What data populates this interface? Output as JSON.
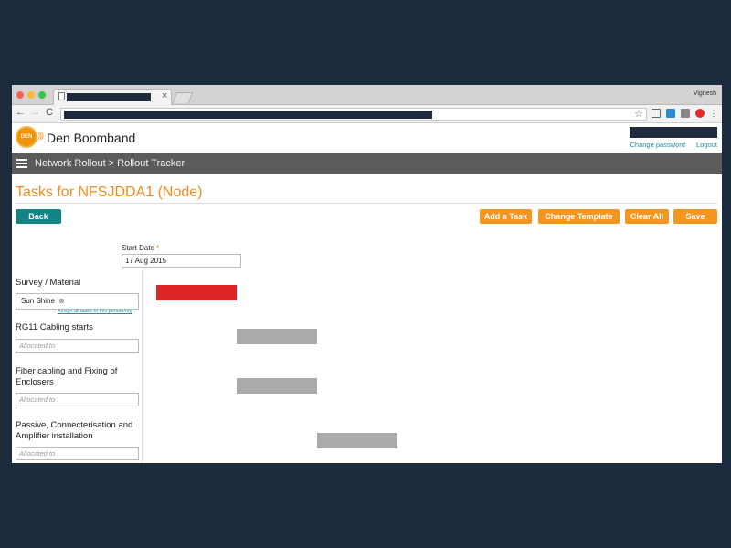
{
  "browser": {
    "profile_name": "Vignesh",
    "tab_close": "×",
    "nav_back": "←",
    "nav_forward": "→",
    "nav_reload": "C",
    "bookmark_star": "☆"
  },
  "header": {
    "logo_text": "DEN",
    "brand": "Den Boomband",
    "links": [
      "Change password",
      "Logout"
    ]
  },
  "nav": {
    "breadcrumb": "Network Rollout > Rollout Tracker"
  },
  "page": {
    "title": "Tasks for NFSJDDA1 (Node)",
    "back_label": "Back",
    "actions": [
      "Add a Task",
      "Change Template",
      "Clear All",
      "Save"
    ],
    "start_date_label": "Start Date",
    "start_date_required": "*",
    "start_date_value": "17 Aug 2015"
  },
  "tasks": [
    {
      "name": "Survey / Material",
      "assignee": "Sun Shine",
      "assignee_remove": "⊗",
      "assign_link": "Assign all tasks to this person/org",
      "allocated_placeholder": "",
      "bar_color": "#dd2523"
    },
    {
      "name": "RG11 Cabling starts",
      "allocated_placeholder": "Allocated to",
      "bar_color": "#aaaaaa"
    },
    {
      "name": "Fiber cabling and Fixing of Enclosers",
      "allocated_placeholder": "Allocated to",
      "bar_color": "#aaaaaa"
    },
    {
      "name": "Passive, Connecterisation and Amplifier installation",
      "allocated_placeholder": "Allocated to",
      "bar_color": "#aaaaaa"
    }
  ],
  "colors": {
    "accent": "#f39622",
    "title": "#f08c1e",
    "teal": "#138385",
    "nav_band": "#5b5b5b",
    "task_done": "#dd2523",
    "task_pending": "#aaaaaa"
  }
}
